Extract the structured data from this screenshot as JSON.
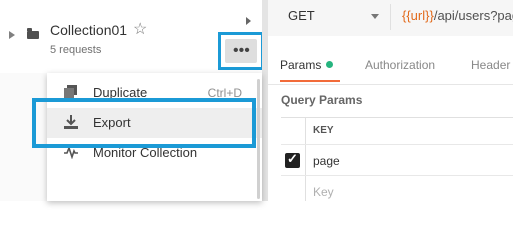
{
  "collection": {
    "name": "Collection01",
    "subtitle": "5 requests",
    "more_label": "•••"
  },
  "context_menu": {
    "items": [
      {
        "label": "Duplicate",
        "shortcut": "Ctrl+D",
        "icon": "duplicate-icon"
      },
      {
        "label": "Export",
        "shortcut": "",
        "icon": "export-icon"
      },
      {
        "label": "Monitor Collection",
        "shortcut": "",
        "icon": "monitor-icon"
      }
    ]
  },
  "request": {
    "method": "GET",
    "url_var": "{{url}}",
    "url_path": "/api/users?pag"
  },
  "tabs": [
    {
      "label": "Params"
    },
    {
      "label": "Authorization"
    },
    {
      "label": "Header"
    }
  ],
  "query_params": {
    "title": "Query Params",
    "key_header": "KEY",
    "rows": [
      {
        "key": "page",
        "checked": true
      }
    ],
    "placeholder": "Key"
  },
  "colors": {
    "highlight": "#1b9ad6",
    "active_tab": "#f26b3a",
    "status_dot": "#26b47f",
    "url_variable": "#e26a1b"
  }
}
